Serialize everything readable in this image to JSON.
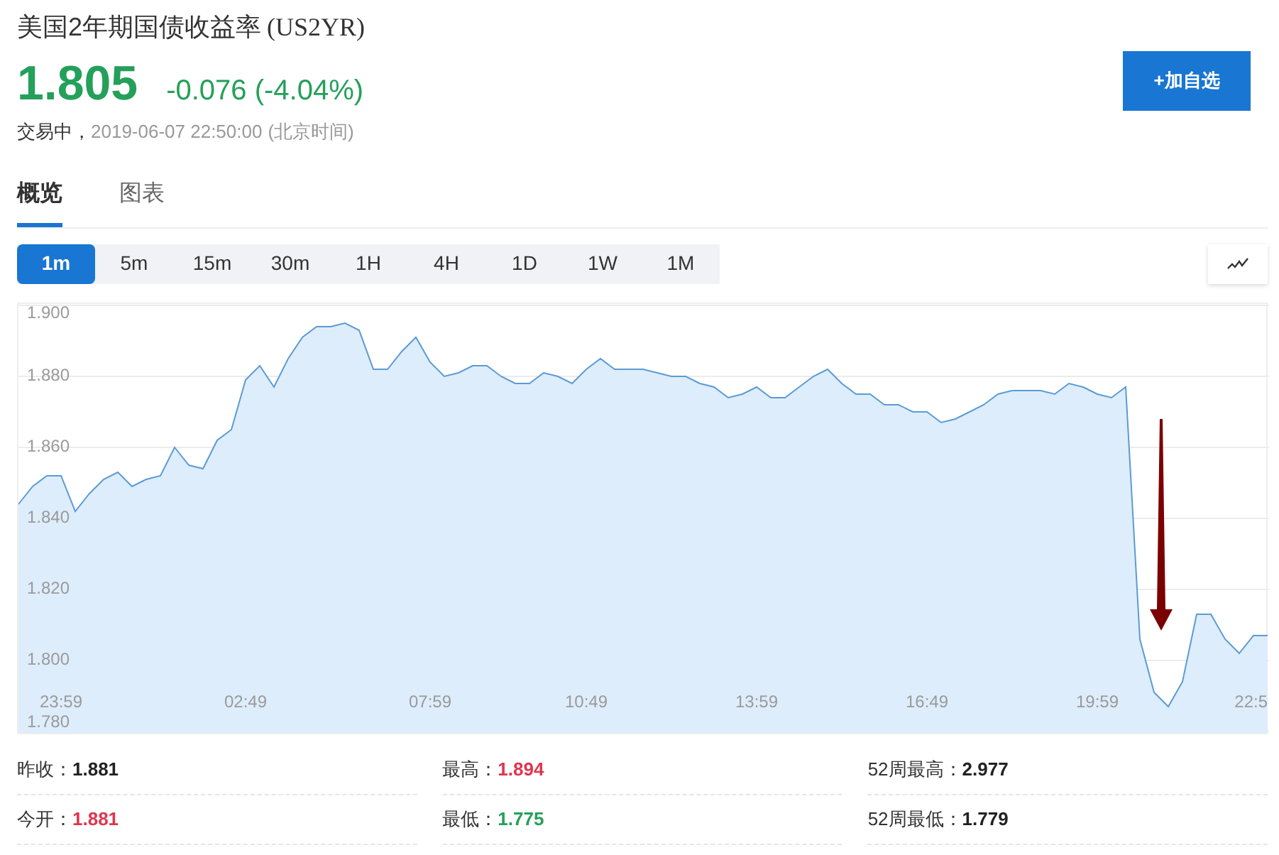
{
  "header": {
    "title": "美国2年期国债收益率",
    "code": "(US2YR)",
    "price": "1.805",
    "change": "-0.076 (-4.04%)",
    "status": "交易中，",
    "timestamp": "2019-06-07 22:50:00",
    "timezone": "(北京时间)",
    "watch_button": "+加自选"
  },
  "tabs": [
    {
      "label": "概览",
      "selected": true
    },
    {
      "label": "图表",
      "selected": false
    }
  ],
  "periods": [
    {
      "label": "1m",
      "selected": true
    },
    {
      "label": "5m",
      "selected": false
    },
    {
      "label": "15m",
      "selected": false
    },
    {
      "label": "30m",
      "selected": false
    },
    {
      "label": "1H",
      "selected": false
    },
    {
      "label": "4H",
      "selected": false
    },
    {
      "label": "1D",
      "selected": false
    },
    {
      "label": "1W",
      "selected": false
    },
    {
      "label": "1M",
      "selected": false
    }
  ],
  "chart": {
    "chart_data": {
      "type": "area",
      "categories": [
        null,
        null,
        null,
        "23:59",
        null,
        null,
        null,
        null,
        null,
        null,
        null,
        null,
        null,
        null,
        null,
        null,
        "02:49",
        null,
        null,
        null,
        null,
        null,
        null,
        null,
        null,
        null,
        null,
        null,
        null,
        "07:59",
        null,
        null,
        null,
        null,
        null,
        null,
        null,
        null,
        null,
        null,
        "10:49",
        null,
        null,
        null,
        null,
        null,
        null,
        null,
        null,
        null,
        null,
        null,
        "13:59",
        null,
        null,
        null,
        null,
        null,
        null,
        null,
        null,
        null,
        null,
        null,
        "16:49",
        null,
        null,
        null,
        null,
        null,
        null,
        null,
        null,
        null,
        null,
        null,
        "19:59",
        null,
        null,
        null,
        null,
        null,
        null,
        null,
        null,
        null,
        null,
        "22:5",
        null
      ],
      "series": [
        {
          "color": "#5b9bd5",
          "values": [
            1.844,
            1.849,
            1.852,
            1.852,
            1.842,
            1.847,
            1.851,
            1.853,
            1.849,
            1.851,
            1.852,
            1.86,
            1.855,
            1.854,
            1.862,
            1.865,
            1.879,
            1.883,
            1.877,
            1.885,
            1.891,
            1.894,
            1.894,
            1.895,
            1.893,
            1.882,
            1.882,
            1.887,
            1.891,
            1.884,
            1.88,
            1.881,
            1.883,
            1.883,
            1.88,
            1.878,
            1.878,
            1.881,
            1.88,
            1.878,
            1.882,
            1.885,
            1.882,
            1.882,
            1.882,
            1.881,
            1.88,
            1.88,
            1.878,
            1.877,
            1.874,
            1.875,
            1.877,
            1.874,
            1.874,
            1.877,
            1.88,
            1.882,
            1.878,
            1.875,
            1.875,
            1.872,
            1.872,
            1.87,
            1.87,
            1.867,
            1.868,
            1.87,
            1.872,
            1.875,
            1.876,
            1.876,
            1.876,
            1.875,
            1.878,
            1.877,
            1.875,
            1.874,
            1.877,
            1.806,
            1.791,
            1.787,
            1.794,
            1.813,
            1.813,
            1.806,
            1.802,
            1.807,
            1.807
          ]
        }
      ],
      "ylim": [
        1.78,
        1.9
      ],
      "grid": true,
      "yticks": [
        {
          "value": 1.9,
          "label": "1.900"
        },
        {
          "value": 1.88,
          "label": "1.880"
        },
        {
          "value": 1.86,
          "label": "1.860"
        },
        {
          "value": 1.84,
          "label": "1.840"
        },
        {
          "value": 1.82,
          "label": "1.820"
        },
        {
          "value": 1.8,
          "label": "1.800"
        },
        {
          "value": 1.78,
          "label": "1.780"
        }
      ]
    }
  },
  "stats": [
    {
      "label": "昨收：",
      "value": "1.881",
      "color": "#222222"
    },
    {
      "label": "最高：",
      "value": "1.894",
      "color": "#e0354f"
    },
    {
      "label": "52周最高：",
      "value": "2.977",
      "color": "#222222"
    },
    {
      "label": "今开：",
      "value": "1.881",
      "color": "#e0354f"
    },
    {
      "label": "最低：",
      "value": "1.775",
      "color": "#24a05a"
    },
    {
      "label": "52周最低：",
      "value": "1.779",
      "color": "#222222"
    }
  ]
}
